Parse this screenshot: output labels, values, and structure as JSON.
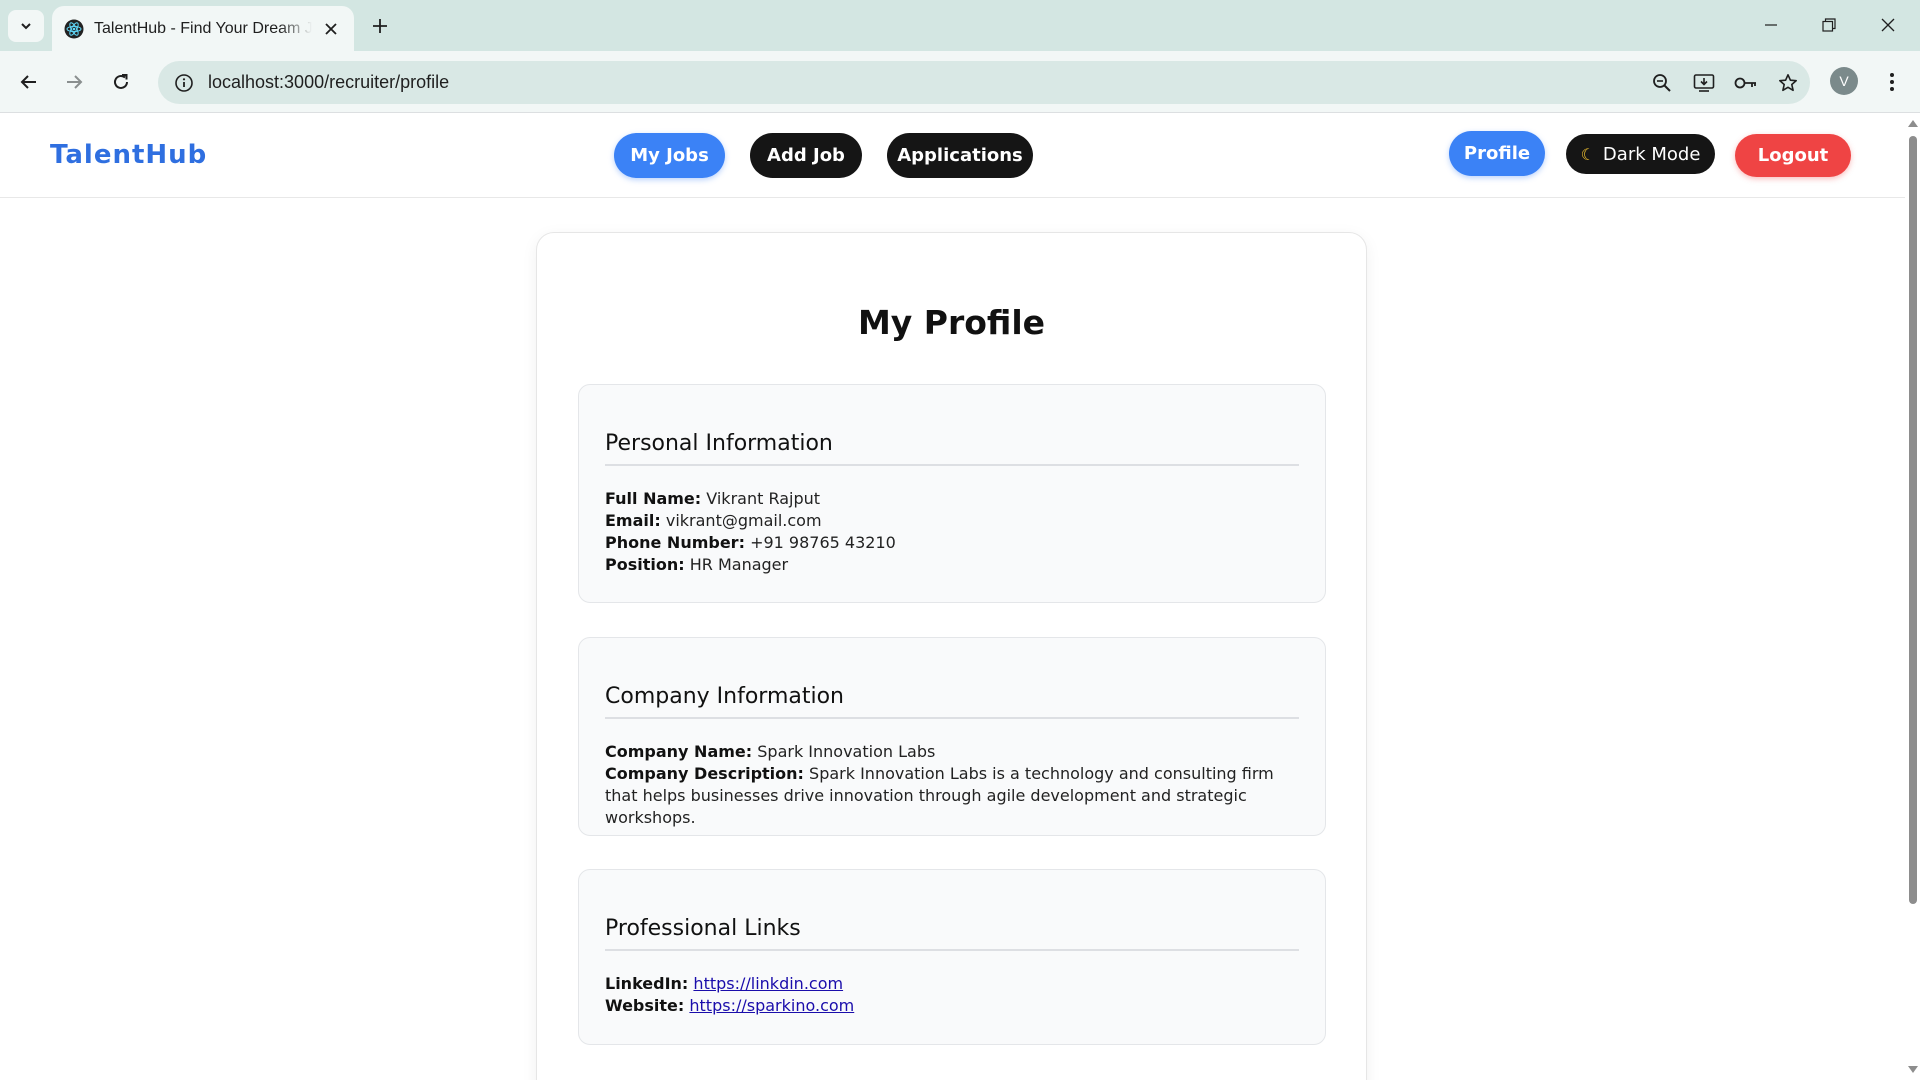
{
  "browser": {
    "tab_title": "TalentHub - Find Your Dream Job",
    "url": "localhost:3000/recruiter/profile",
    "profile_initial": "V"
  },
  "nav": {
    "brand": "TalentHub",
    "my_jobs": "My Jobs",
    "add_job": "Add Job",
    "applications": "Applications",
    "profile": "Profile",
    "dark_mode": "Dark Mode",
    "logout": "Logout"
  },
  "page": {
    "title": "My Profile"
  },
  "personal": {
    "heading": "Personal Information",
    "full_name_label": "Full Name:",
    "full_name": "Vikrant Rajput",
    "email_label": "Email:",
    "email": "vikrant@gmail.com",
    "phone_label": "Phone Number:",
    "phone": "+91 98765 43210",
    "position_label": "Position:",
    "position": "HR Manager"
  },
  "company": {
    "heading": "Company Information",
    "name_label": "Company Name:",
    "name": "Spark Innovation Labs",
    "description_label": "Company Description:",
    "description": "Spark Innovation Labs is a technology and consulting firm that helps businesses drive innovation through agile development and strategic workshops."
  },
  "links": {
    "heading": "Professional Links",
    "linkedin_label": "LinkedIn:",
    "linkedin": "https://linkdin.com",
    "website_label": "Website:",
    "website": "https://sparkino.com"
  },
  "colors": {
    "brand": "#2f6fe0",
    "primary": "#3b82f6",
    "danger": "#ef4444",
    "dark": "#151515"
  }
}
